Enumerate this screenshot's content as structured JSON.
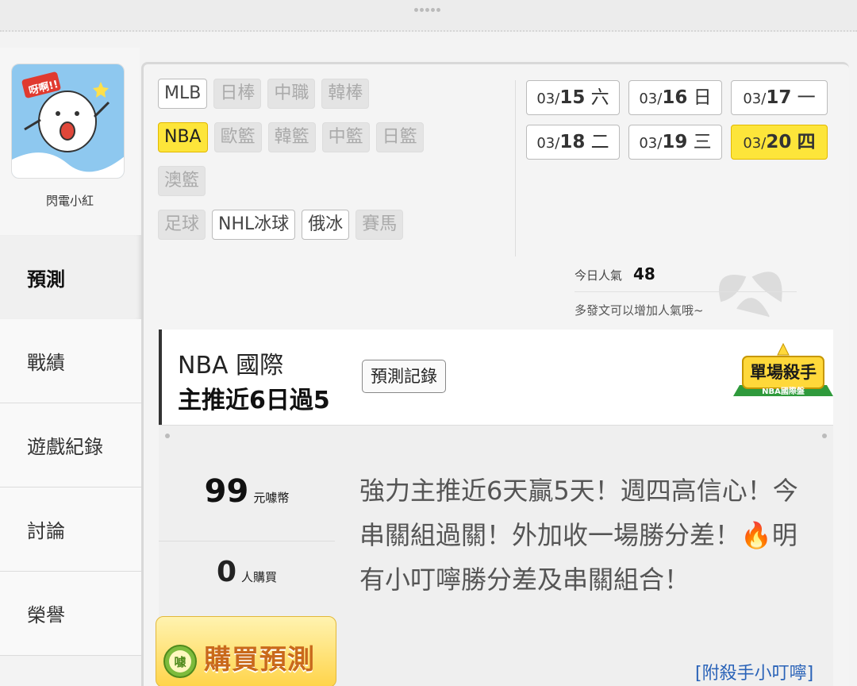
{
  "user": {
    "name": "閃電小紅",
    "avatar_text": "呀啊!!"
  },
  "nav": {
    "items": [
      "預測",
      "戰績",
      "遊戲紀錄",
      "討論",
      "榮譽"
    ],
    "active": "預測"
  },
  "sports": {
    "rows": [
      [
        {
          "label": "MLB",
          "state": "normal"
        },
        {
          "label": "日棒",
          "state": "disabled"
        },
        {
          "label": "中職",
          "state": "disabled"
        },
        {
          "label": "韓棒",
          "state": "disabled"
        }
      ],
      [
        {
          "label": "NBA",
          "state": "active"
        },
        {
          "label": "歐籃",
          "state": "disabled"
        },
        {
          "label": "韓籃",
          "state": "disabled"
        },
        {
          "label": "中籃",
          "state": "disabled"
        },
        {
          "label": "日籃",
          "state": "disabled"
        }
      ],
      [
        {
          "label": "澳籃",
          "state": "disabled"
        }
      ],
      [
        {
          "label": "足球",
          "state": "disabled"
        },
        {
          "label": "NHL冰球",
          "state": "normal"
        },
        {
          "label": "俄冰",
          "state": "normal"
        },
        {
          "label": "賽馬",
          "state": "disabled"
        }
      ]
    ]
  },
  "dates": [
    {
      "month": "03/",
      "day": "15",
      "weekday": "六",
      "active": false
    },
    {
      "month": "03/",
      "day": "16",
      "weekday": "日",
      "active": false
    },
    {
      "month": "03/",
      "day": "17",
      "weekday": "一",
      "active": false
    },
    {
      "month": "03/",
      "day": "18",
      "weekday": "二",
      "active": false
    },
    {
      "month": "03/",
      "day": "19",
      "weekday": "三",
      "active": false
    },
    {
      "month": "03/",
      "day": "20",
      "weekday": "四",
      "active": true
    }
  ],
  "popularity": {
    "label": "今日人氣",
    "value": "48",
    "hint": "多發文可以增加人氣哦~"
  },
  "card": {
    "league": "NBA 國際",
    "title": "主推近6日過5",
    "record_button": "預測記錄",
    "badge_title": "單場殺手",
    "badge_sub": "NBA國際盤",
    "price": "99",
    "price_unit": "元噱幣",
    "buyers": "0",
    "buyers_unit": "人購買",
    "description": "強力主推近6天贏5天！週四高信心！今串關組過關！外加收一場勝分差！🔥明有小叮嚀勝分差及串關組合！",
    "buy_label": "購買預測",
    "buy_coin_text": "噱",
    "attach_link": "[附殺手小叮嚀]"
  }
}
